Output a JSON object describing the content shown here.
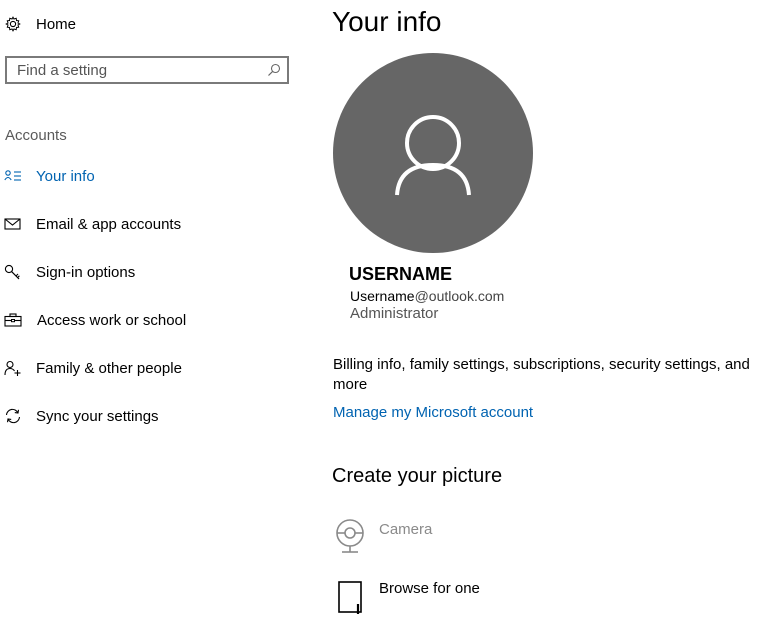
{
  "sidebar": {
    "home_label": "Home",
    "search": {
      "placeholder": "Find a setting"
    },
    "section_heading": "Accounts",
    "items": [
      {
        "label": "Your info",
        "icon": "user-list-icon",
        "active": true
      },
      {
        "label": "Email & app accounts",
        "icon": "mail-icon"
      },
      {
        "label": "Sign-in options",
        "icon": "key-icon"
      },
      {
        "label": "Access work or school",
        "icon": "briefcase-icon"
      },
      {
        "label": "Family & other people",
        "icon": "add-person-icon"
      },
      {
        "label": "Sync your settings",
        "icon": "sync-icon"
      }
    ]
  },
  "main": {
    "title": "Your info",
    "user": {
      "name": "USERNAME",
      "email_local": "Username",
      "email_domain": "@outlook.com",
      "role": "Administrator"
    },
    "billing_text": "Billing info, family settings, subscriptions, security settings, and more",
    "manage_link": "Manage my Microsoft account",
    "create_picture": {
      "title": "Create your picture",
      "options": [
        {
          "label": "Camera",
          "icon": "webcam-icon",
          "enabled": false
        },
        {
          "label": "Browse for one",
          "icon": "folder-icon",
          "enabled": true
        }
      ]
    }
  },
  "colors": {
    "accent": "#0063b1",
    "avatar_bg": "#666666",
    "disabled_text": "#8a8a8a"
  }
}
